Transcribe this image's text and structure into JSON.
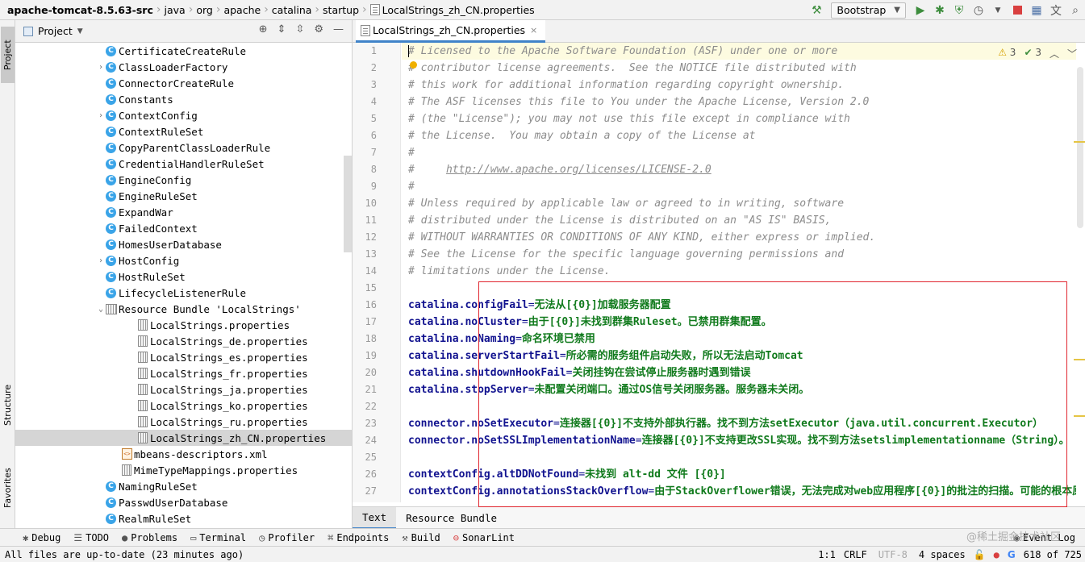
{
  "breadcrumb": [
    "apache-tomcat-8.5.63-src",
    "java",
    "org",
    "apache",
    "catalina",
    "startup",
    "LocalStrings_zh_CN.properties"
  ],
  "run_config": "Bootstrap",
  "side_tabs": {
    "project": "Project",
    "structure": "Structure",
    "favorites": "Favorites"
  },
  "project_panel": {
    "title": "Project",
    "items": [
      {
        "label": "CertificateCreateRule",
        "type": "class",
        "expandable": false
      },
      {
        "label": "ClassLoaderFactory",
        "type": "class",
        "expandable": true
      },
      {
        "label": "ConnectorCreateRule",
        "type": "class",
        "expandable": false
      },
      {
        "label": "Constants",
        "type": "class",
        "expandable": false
      },
      {
        "label": "ContextConfig",
        "type": "class",
        "expandable": true
      },
      {
        "label": "ContextRuleSet",
        "type": "class",
        "expandable": false
      },
      {
        "label": "CopyParentClassLoaderRule",
        "type": "class",
        "expandable": false
      },
      {
        "label": "CredentialHandlerRuleSet",
        "type": "class",
        "expandable": false
      },
      {
        "label": "EngineConfig",
        "type": "class",
        "expandable": false
      },
      {
        "label": "EngineRuleSet",
        "type": "class",
        "expandable": false
      },
      {
        "label": "ExpandWar",
        "type": "class",
        "expandable": false
      },
      {
        "label": "FailedContext",
        "type": "class",
        "expandable": false
      },
      {
        "label": "HomesUserDatabase",
        "type": "class",
        "expandable": false
      },
      {
        "label": "HostConfig",
        "type": "class",
        "expandable": true
      },
      {
        "label": "HostRuleSet",
        "type": "class",
        "expandable": false
      },
      {
        "label": "LifecycleListenerRule",
        "type": "class",
        "expandable": false
      },
      {
        "label": "Resource Bundle 'LocalStrings'",
        "type": "bundle",
        "expandable": true
      },
      {
        "label": "LocalStrings.properties",
        "type": "prop",
        "expandable": false
      },
      {
        "label": "LocalStrings_de.properties",
        "type": "prop",
        "expandable": false
      },
      {
        "label": "LocalStrings_es.properties",
        "type": "prop",
        "expandable": false
      },
      {
        "label": "LocalStrings_fr.properties",
        "type": "prop",
        "expandable": false
      },
      {
        "label": "LocalStrings_ja.properties",
        "type": "prop",
        "expandable": false
      },
      {
        "label": "LocalStrings_ko.properties",
        "type": "prop",
        "expandable": false
      },
      {
        "label": "LocalStrings_ru.properties",
        "type": "prop",
        "expandable": false
      },
      {
        "label": "LocalStrings_zh_CN.properties",
        "type": "prop",
        "expandable": false,
        "selected": true
      },
      {
        "label": "mbeans-descriptors.xml",
        "type": "xml",
        "expandable": false
      },
      {
        "label": "MimeTypeMappings.properties",
        "type": "prop-root",
        "expandable": false
      },
      {
        "label": "NamingRuleSet",
        "type": "class",
        "expandable": false
      },
      {
        "label": "PasswdUserDatabase",
        "type": "class",
        "expandable": false
      },
      {
        "label": "RealmRuleSet",
        "type": "class",
        "expandable": false
      }
    ]
  },
  "editor": {
    "tab_label": "LocalStrings_zh_CN.properties",
    "inspection_warnings": "3",
    "inspection_ok": "3",
    "lines": [
      {
        "n": "1",
        "kind": "comment",
        "text": "# Licensed to the Apache Software Foundation (ASF) under one or more"
      },
      {
        "n": "2",
        "kind": "comment",
        "text": "# contributor license agreements.  See the NOTICE file distributed with"
      },
      {
        "n": "3",
        "kind": "comment",
        "text": "# this work for additional information regarding copyright ownership."
      },
      {
        "n": "4",
        "kind": "comment",
        "text": "# The ASF licenses this file to You under the Apache License, Version 2.0"
      },
      {
        "n": "5",
        "kind": "comment",
        "text": "# (the \"License\"); you may not use this file except in compliance with"
      },
      {
        "n": "6",
        "kind": "comment",
        "text": "# the License.  You may obtain a copy of the License at"
      },
      {
        "n": "7",
        "kind": "comment",
        "text": "#"
      },
      {
        "n": "8",
        "kind": "comment-link",
        "text": "#     ",
        "link": "http://www.apache.org/licenses/LICENSE-2.0"
      },
      {
        "n": "9",
        "kind": "comment",
        "text": "#"
      },
      {
        "n": "10",
        "kind": "comment",
        "text": "# Unless required by applicable law or agreed to in writing, software"
      },
      {
        "n": "11",
        "kind": "comment",
        "text": "# distributed under the License is distributed on an \"AS IS\" BASIS,"
      },
      {
        "n": "12",
        "kind": "comment",
        "text": "# WITHOUT WARRANTIES OR CONDITIONS OF ANY KIND, either express or implied."
      },
      {
        "n": "13",
        "kind": "comment",
        "text": "# See the License for the specific language governing permissions and"
      },
      {
        "n": "14",
        "kind": "comment",
        "text": "# limitations under the License."
      },
      {
        "n": "15",
        "kind": "blank",
        "text": ""
      },
      {
        "n": "16",
        "kind": "prop",
        "key": "catalina.configFail",
        "value": "无法从[{0}]加载服务器配置"
      },
      {
        "n": "17",
        "kind": "prop",
        "key": "catalina.noCluster",
        "value": "由于[{0}]未找到群集Ruleset。已禁用群集配置。"
      },
      {
        "n": "18",
        "kind": "prop",
        "key": "catalina.noNaming",
        "value": "命名环境已禁用"
      },
      {
        "n": "19",
        "kind": "prop",
        "key": "catalina.serverStartFail",
        "value": "所必需的服务组件启动失败，所以无法启动Tomcat"
      },
      {
        "n": "20",
        "kind": "prop",
        "key": "catalina.shutdownHookFail",
        "value": "关闭挂钩在尝试停止服务器时遇到错误"
      },
      {
        "n": "21",
        "kind": "prop",
        "key": "catalina.stopServer",
        "value": "未配置关闭端口。通过OS信号关闭服务器。服务器未关闭。"
      },
      {
        "n": "22",
        "kind": "blank",
        "text": ""
      },
      {
        "n": "23",
        "kind": "prop",
        "key": "connector.noSetExecutor",
        "value": "连接器[{0}]不支持外部执行器。找不到方法setExecutor（java.util.concurrent.Executor）"
      },
      {
        "n": "24",
        "kind": "prop",
        "key": "connector.noSetSSLImplementationName",
        "value": "连接器[{0}]不支持更改SSL实现。找不到方法setslimplementationname（String）。"
      },
      {
        "n": "25",
        "kind": "blank",
        "text": ""
      },
      {
        "n": "26",
        "kind": "prop",
        "key": "contextConfig.altDDNotFound",
        "value": "未找到 alt-dd 文件 [{0}]"
      },
      {
        "n": "27",
        "kind": "prop",
        "key": "contextConfig.annotationsStackOverflow",
        "value": "由于StackOverflower错误，无法完成对web应用程序[{0}]的批注的扫描。可能的根本原因"
      }
    ],
    "bottom_tabs": [
      "Text",
      "Resource Bundle"
    ]
  },
  "tool_windows": [
    "Debug",
    "TODO",
    "Problems",
    "Terminal",
    "Profiler",
    "Endpoints",
    "Build",
    "SonarLint"
  ],
  "event_log": "Event Log",
  "status": {
    "message": "All files are up-to-date (23 minutes ago)",
    "position": "1:1",
    "line_sep": "CRLF",
    "encoding": "UTF-8",
    "indent": "4 spaces",
    "memory": "618 of 725"
  },
  "watermark": "@稀土掘金技术社区",
  "colors": {
    "accent": "#4083c9",
    "annotation": "#e0262f",
    "prop_key": "#11128f",
    "prop_value": "#107a1c",
    "comment": "#8c8c8c"
  }
}
